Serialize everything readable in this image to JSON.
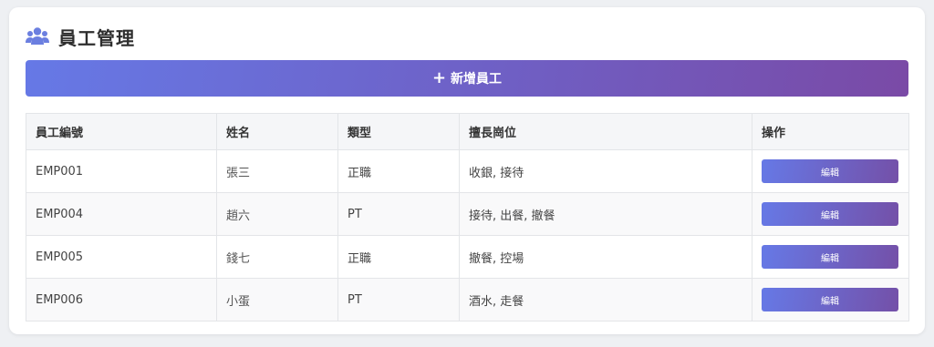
{
  "header": {
    "title": "員工管理",
    "icon": "users-icon"
  },
  "actions": {
    "add_label": "新增員工",
    "add_icon": "plus-icon"
  },
  "table": {
    "columns": [
      "員工編號",
      "姓名",
      "類型",
      "擅長崗位",
      "操作"
    ],
    "rows": [
      {
        "id": "EMP001",
        "name": "張三",
        "type": "正職",
        "skills": "收銀, 接待",
        "action": "編輯"
      },
      {
        "id": "EMP004",
        "name": "趙六",
        "type": "PT",
        "skills": "接待, 出餐, 撤餐",
        "action": "編輯"
      },
      {
        "id": "EMP005",
        "name": "錢七",
        "type": "正職",
        "skills": "撤餐, 控場",
        "action": "編輯"
      },
      {
        "id": "EMP006",
        "name": "小蛋",
        "type": "PT",
        "skills": "酒水, 走餐",
        "action": "編輯"
      }
    ]
  },
  "colors": {
    "accent_start": "#6679e6",
    "accent_end": "#7a4aa6",
    "icon": "#6b7fe0"
  }
}
